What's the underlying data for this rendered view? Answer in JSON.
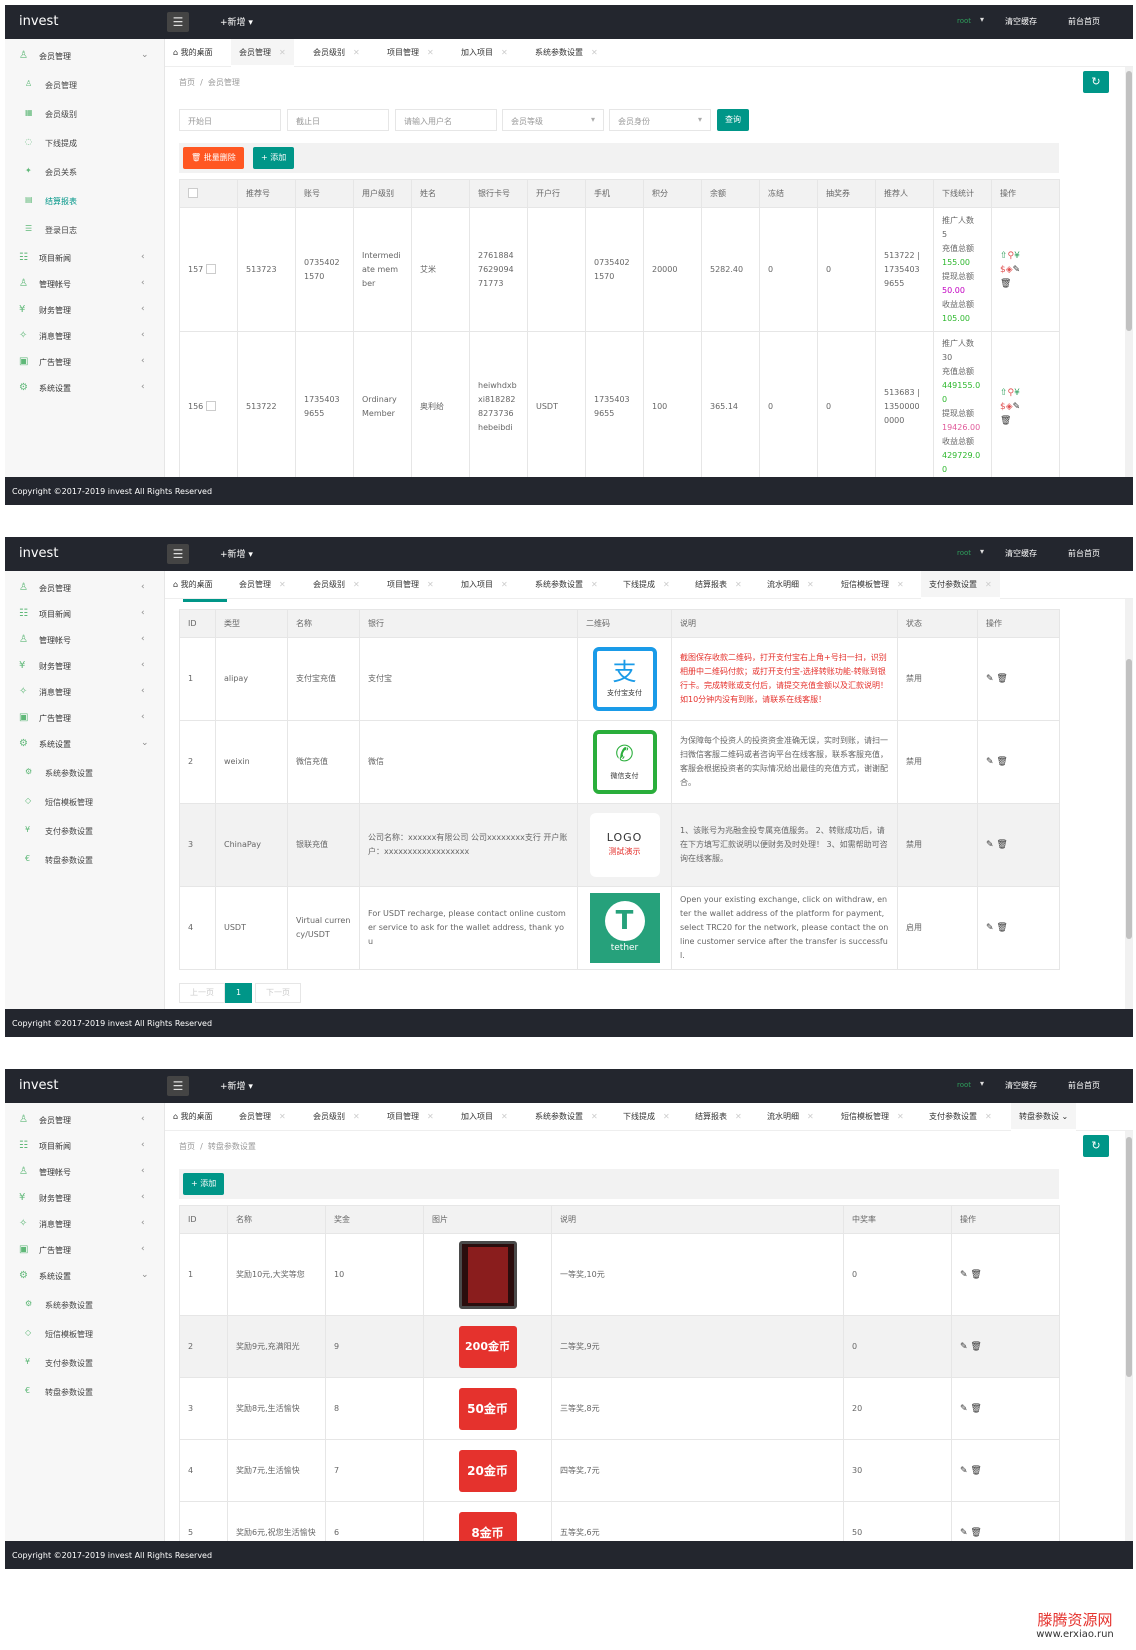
{
  "common": {
    "brand": "invest",
    "menu_icon": "☰",
    "new_label": "+新增",
    "user": "root",
    "caret": "▾",
    "clear_cache": "清空缓存",
    "front_home": "前台首页",
    "copyright": "Copyright ©2017-2019 invest All Rights Reserved",
    "crumb_home": "首页",
    "crumb_sep": "/",
    "refresh_icon": "↻",
    "close": "✕",
    "home_icon": "⌂",
    "chev_down": "⌄",
    "chev_left": "‹",
    "accent": "#009688"
  },
  "shot1": {
    "sidebar": {
      "members": "会员管理",
      "sub": [
        "会员管理",
        "会员级别",
        "下线提成",
        "会员关系",
        "结算报表",
        "登录日志"
      ],
      "others": [
        "项目新闻",
        "管理帐号",
        "财务管理",
        "消息管理",
        "广告管理",
        "系统设置"
      ]
    },
    "tabs": [
      "我的桌面",
      "会员管理",
      "会员级别",
      "项目管理",
      "加入项目",
      "系统参数设置"
    ],
    "crumb": "会员管理",
    "filters": {
      "start": "开始日",
      "end": "截止日",
      "username": "请输入用户名",
      "level": "会员等级",
      "identity": "会员身份",
      "query": "查询"
    },
    "batch_delete": "🗑 批量删除",
    "add": "+ 添加",
    "headers": [
      "",
      "推荐号",
      "账号",
      "用户级别",
      "姓名",
      "银行卡号",
      "开户行",
      "手机",
      "积分",
      "余额",
      "冻结",
      "抽奖券",
      "推荐人",
      "下线统计",
      "操作"
    ],
    "rows": [
      {
        "id": "157",
        "ref": "513723",
        "account": "0735402 1570",
        "level": "Intermedi ate mem ber",
        "name": "艾米",
        "card": "2761884 7629094 71773",
        "bank": "",
        "phone": "0735402 1570",
        "points": "20000",
        "balance": "5282.40",
        "frozen": "0",
        "tickets": "0",
        "referrer": "513722 | 1735403 9655",
        "stat": [
          "推广人数",
          "5",
          "充值总额",
          "155.00",
          "提现总额",
          "50.00",
          "收益总额",
          "105.00"
        ]
      },
      {
        "id": "156",
        "ref": "513722",
        "account": "1735403 9655",
        "level": "Ordinary Member",
        "name": "奥利给",
        "card": "heiwhdxb xi818282 8273736 hebeibdi",
        "bank": "USDT",
        "phone": "1735403 9655",
        "points": "100",
        "balance": "365.14",
        "frozen": "0",
        "tickets": "0",
        "referrer": "513683 | 1350000 0000",
        "stat": [
          "推广人数",
          "30",
          "充值总额",
          "449155.0 0",
          "提现总额",
          "19426.00",
          "收益总额",
          "429729.0 0"
        ]
      }
    ]
  },
  "shot2": {
    "sidebar": {
      "top": [
        "会员管理",
        "项目新闻",
        "管理帐号",
        "财务管理",
        "消息管理",
        "广告管理"
      ],
      "system": "系统设置",
      "sub": [
        "系统参数设置",
        "短信模板管理",
        "支付参数设置",
        "转盘参数设置"
      ]
    },
    "tabs": [
      "我的桌面",
      "会员管理",
      "会员级别",
      "项目管理",
      "加入项目",
      "系统参数设置",
      "下线提成",
      "结算报表",
      "流水明细",
      "短信模板管理",
      "支付参数设置"
    ],
    "headers": [
      "ID",
      "类型",
      "名称",
      "银行",
      "二维码",
      "说明",
      "状态",
      "操作"
    ],
    "rows": [
      {
        "id": "1",
        "type": "alipay",
        "name": "支付宝充值",
        "bank": "支付宝",
        "qr_text": "支付宝支付",
        "qr_glyph": "支",
        "desc_red": "截图保存收款二维码，打开支付宝右上角+号扫一扫，识别相册中二维码付款；或打开支付宝-选择转账功能-转账到银行卡。完成转账或支付后，请提交充值金额以及汇款说明！如10分钟内没有到账，请联系在线客服！",
        "status": "禁用"
      },
      {
        "id": "2",
        "type": "weixin",
        "name": "微信充值",
        "bank": "微信",
        "qr_text": "微信支付",
        "qr_glyph": "✆",
        "desc": "为保障每个投资人的投资资金准确无误，实时到账，请扫一扫微信客服二维码或者咨询平台在线客服，联系客服充值，客服会根据投资者的实际情况给出最佳的充值方式，谢谢配合。",
        "status": "禁用"
      },
      {
        "id": "3",
        "type": "ChinaPay",
        "name": "银联充值",
        "bank": "公司名称：xxxxxx有限公司 公司xxxxxxxx支行 开户账户：xxxxxxxxxxxxxxxxxx",
        "qr_text": "测試演示",
        "qr_glyph": "LOGO",
        "desc": "1、该账号为兆融金投专属充值服务。 2、转账成功后，请在下方填写汇款说明以便财务及时处理！ 3、如需帮助可咨询在线客服。",
        "status": "禁用"
      },
      {
        "id": "4",
        "type": "USDT",
        "name": "Virtual curren cy/USDT",
        "bank": "For USDT recharge, please contact online customer service to ask for the wallet address, thank you",
        "qr_text": "tether",
        "qr_glyph": "T",
        "desc": "Open your existing exchange, click on withdraw, enter the wallet address of the platform for payment, select TRC20 for the network, please contact the online customer service after the transfer is successful.",
        "status": "启用"
      }
    ],
    "pager": [
      "上一页",
      "1",
      "下一页"
    ]
  },
  "shot3": {
    "sidebar": {
      "top": [
        "会员管理",
        "项目新闻",
        "管理帐号",
        "财务管理",
        "消息管理",
        "广告管理"
      ],
      "system": "系统设置",
      "sub": [
        "系统参数设置",
        "短信模板管理",
        "支付参数设置",
        "转盘参数设置"
      ]
    },
    "tabs": [
      "我的桌面",
      "会员管理",
      "会员级别",
      "项目管理",
      "加入项目",
      "系统参数设置",
      "下线提成",
      "结算报表",
      "流水明细",
      "短信模板管理",
      "支付参数设置",
      "转盘参数设"
    ],
    "crumb": "转盘参数设置",
    "add": "+ 添加",
    "headers": [
      "ID",
      "名称",
      "奖金",
      "图片",
      "说明",
      "中奖率",
      "操作"
    ],
    "rows": [
      {
        "id": "1",
        "name": "奖励10元,大奖等您",
        "prize": "10",
        "img": "",
        "desc": "一等奖,10元",
        "rate": "0"
      },
      {
        "id": "2",
        "name": "奖励9元,充满阳光",
        "prize": "9",
        "img": "200金币",
        "desc": "二等奖,9元",
        "rate": "0"
      },
      {
        "id": "3",
        "name": "奖励8元,生活愉快",
        "prize": "8",
        "img": "50金币",
        "desc": "三等奖,8元",
        "rate": "20"
      },
      {
        "id": "4",
        "name": "奖励7元,生活愉快",
        "prize": "7",
        "img": "20金币",
        "desc": "四等奖,7元",
        "rate": "30"
      },
      {
        "id": "5",
        "name": "奖励6元,祝您生活愉快",
        "prize": "6",
        "img": "8金币",
        "desc": "五等奖,6元",
        "rate": "50"
      }
    ]
  },
  "watermark": {
    "title": "滕腾资源网",
    "url": "www.erxiao.run"
  }
}
